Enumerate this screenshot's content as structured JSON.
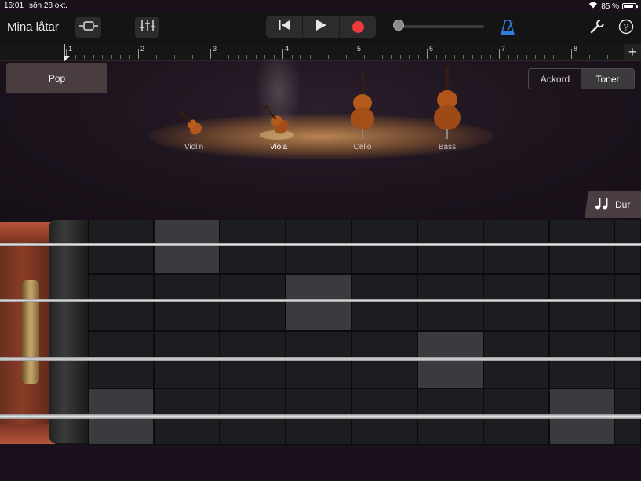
{
  "status": {
    "time": "16:01",
    "date": "sön 28 okt.",
    "battery_pct": "85 %",
    "battery_level": 0.85
  },
  "toolbar": {
    "my_songs": "Mina låtar",
    "icons": [
      "view-toggle-icon",
      "mixer-icon",
      "rewind-icon",
      "play-icon",
      "record-icon",
      "metronome-icon",
      "wrench-icon",
      "help-icon"
    ],
    "volume_level": 0.05
  },
  "ruler": {
    "bars": [
      "1",
      "2",
      "3",
      "4",
      "5",
      "6",
      "7",
      "8"
    ]
  },
  "preset": {
    "label": "Pop"
  },
  "mode": {
    "options": [
      "Ackord",
      "Toner"
    ],
    "selected": "Toner"
  },
  "instruments": [
    {
      "name": "Violin",
      "selected": false
    },
    {
      "name": "Viola",
      "selected": true
    },
    {
      "name": "Cello",
      "selected": false
    },
    {
      "name": "Bass",
      "selected": false
    }
  ],
  "scale": {
    "label": "Dur"
  },
  "colors": {
    "record": "#f03a3a",
    "metronome": "#2f7de1",
    "preset_bg": "#4a3d40"
  }
}
